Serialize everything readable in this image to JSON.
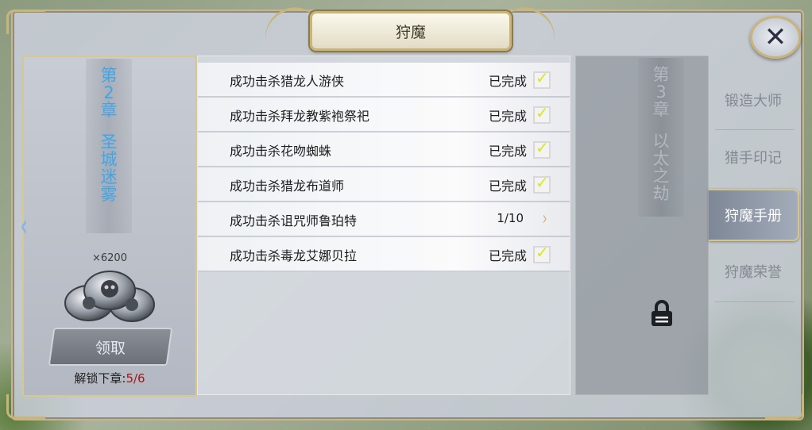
{
  "window": {
    "title": "狩魔",
    "close_symbol": "✕"
  },
  "chapter_current": {
    "number_lines": [
      "第",
      "2",
      "章"
    ],
    "name_lines": [
      "圣",
      "城",
      "迷",
      "雾"
    ],
    "reward_count": "×6200",
    "reward_icon": "silver-coin-stack-icon",
    "claim_label": "领取",
    "unlock_label": "解锁下章:",
    "unlock_progress": "5/6",
    "prev_arrow": "‹"
  },
  "tasks": [
    {
      "name": "成功击杀猎龙人游侠",
      "status": "已完成",
      "done": true
    },
    {
      "name": "成功击杀拜龙教紫袍祭祀",
      "status": "已完成",
      "done": true
    },
    {
      "name": "成功击杀花吻蜘蛛",
      "status": "已完成",
      "done": true
    },
    {
      "name": "成功击杀猎龙布道师",
      "status": "已完成",
      "done": true
    },
    {
      "name": "成功击杀诅咒师鲁珀特",
      "status": "1/10",
      "done": false
    },
    {
      "name": "成功击杀毒龙艾娜贝拉",
      "status": "已完成",
      "done": true
    }
  ],
  "chapter_locked": {
    "number_lines": [
      "第",
      "3",
      "章"
    ],
    "name_lines": [
      "以",
      "太",
      "之",
      "劫"
    ],
    "lock_icon": "padlock-icon"
  },
  "tabs": [
    {
      "label": "锻造大师",
      "active": false
    },
    {
      "label": "猎手印记",
      "active": false
    },
    {
      "label": "狩魔手册",
      "active": true
    },
    {
      "label": "狩魔荣誉",
      "active": false
    }
  ],
  "colors": {
    "chapter_text": "#3fa6ea",
    "check_mark": "#d9e81b",
    "progress_red": "#a21818",
    "frame_gold": "#c9b47b"
  }
}
